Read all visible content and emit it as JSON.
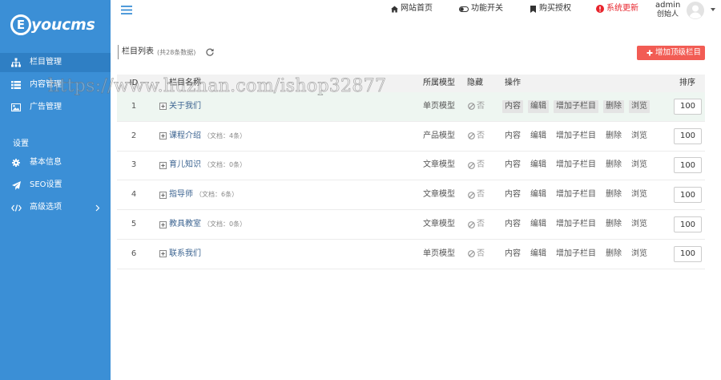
{
  "logo": {
    "mark": "E",
    "text": "youcms"
  },
  "sidebar": {
    "items": [
      {
        "label": "栏目管理",
        "icon": "sitemap-icon",
        "active": true
      },
      {
        "label": "内容管理",
        "icon": "list-icon"
      },
      {
        "label": "广告管理",
        "icon": "image-icon"
      }
    ],
    "settings_title": "设置",
    "settings_items": [
      {
        "label": "基本信息",
        "icon": "gear-icon"
      },
      {
        "label": "SEO设置",
        "icon": "send-icon"
      },
      {
        "label": "高级选项",
        "icon": "code-icon",
        "has_submenu": true
      }
    ]
  },
  "header": {
    "nav": [
      {
        "label": "网站首页",
        "icon": "home-icon"
      },
      {
        "label": "功能开关",
        "icon": "toggle-icon"
      },
      {
        "label": "购买授权",
        "icon": "bookmark-icon"
      },
      {
        "label": "系统更新",
        "icon": "info-icon",
        "alert": true
      }
    ],
    "user": {
      "name": "admin",
      "role": "创始人"
    }
  },
  "panel": {
    "title": "栏目列表",
    "count": "(共28条数据)",
    "add_button": "增加顶级栏目"
  },
  "table": {
    "columns": {
      "id": "ID",
      "name": "栏目名称",
      "model": "所属模型",
      "hidden": "隐藏",
      "actions": "操作",
      "sort": "排序"
    },
    "actions": [
      "内容",
      "编辑",
      "增加子栏目",
      "删除",
      "浏览"
    ],
    "rows": [
      {
        "id": "1",
        "name": "关于我们",
        "model": "单页模型",
        "hidden": "否",
        "sort": "100",
        "highlighted": true
      },
      {
        "id": "2",
        "name": "课程介绍",
        "doc_count": "（文档：4条）",
        "model": "产品模型",
        "hidden": "否",
        "sort": "100"
      },
      {
        "id": "3",
        "name": "育儿知识",
        "doc_count": "（文档：0条）",
        "model": "文章模型",
        "hidden": "否",
        "sort": "100"
      },
      {
        "id": "4",
        "name": "指导师",
        "doc_count": "（文档：6条）",
        "model": "文章模型",
        "hidden": "否",
        "sort": "100"
      },
      {
        "id": "5",
        "name": "教具教室",
        "doc_count": "（文档：0条）",
        "model": "文章模型",
        "hidden": "否",
        "sort": "100"
      },
      {
        "id": "6",
        "name": "联系我们",
        "model": "单页模型",
        "hidden": "否",
        "sort": "100"
      }
    ]
  },
  "watermark": "https://www.huzhan.com/ishop32877",
  "colors": {
    "sidebar_bg": "#3b8fd6",
    "sidebar_active": "#2f7fc4",
    "danger": "#e8242c",
    "button_bg": "#f25c54",
    "link": "#3c6491",
    "row_highlight": "#eef6f1"
  }
}
